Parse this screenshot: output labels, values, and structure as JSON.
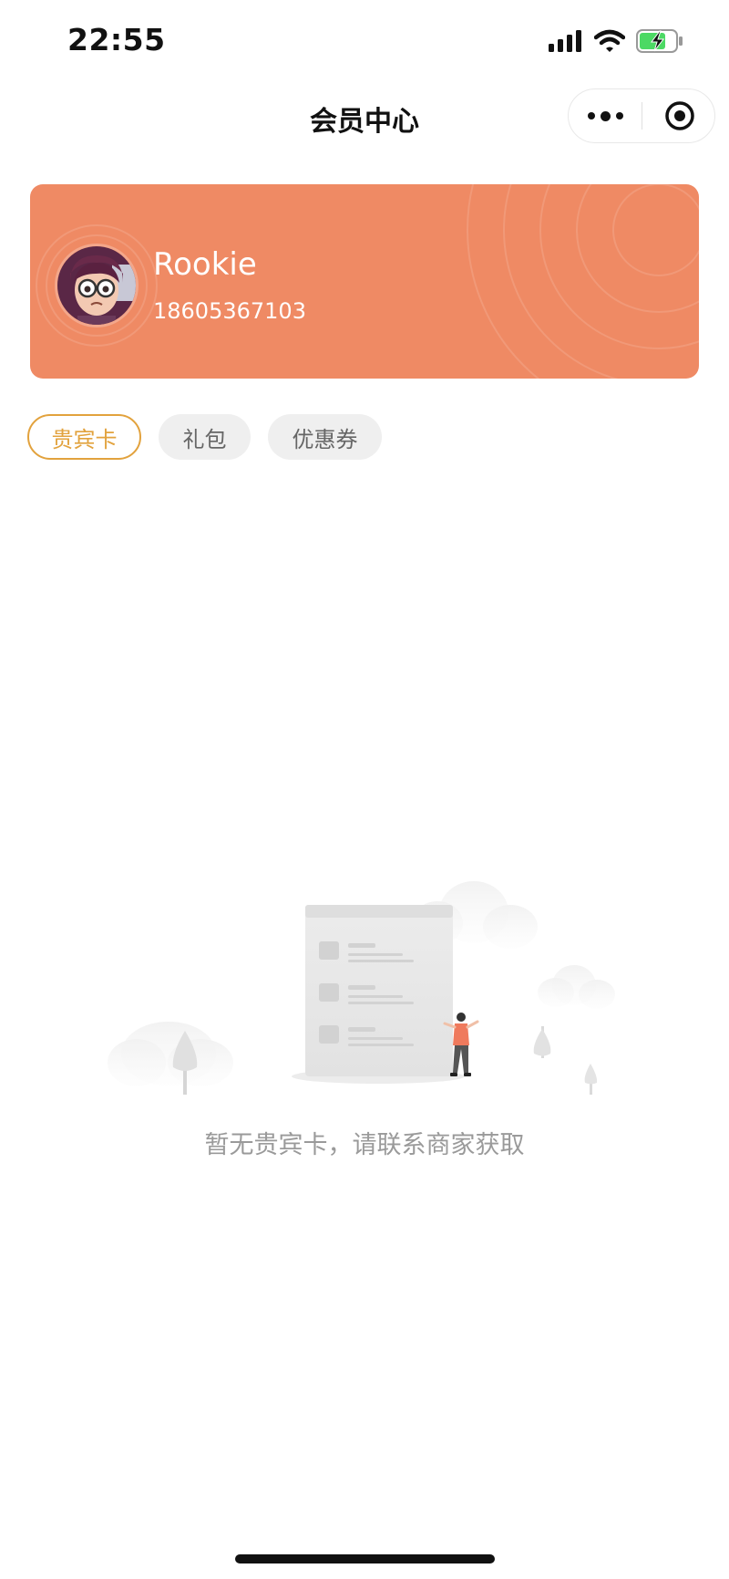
{
  "status_bar": {
    "time": "22:55",
    "icons": [
      "signal-icon",
      "wifi-icon",
      "battery-charging-icon"
    ]
  },
  "nav": {
    "title": "会员中心",
    "more_icon": "more-dots-icon",
    "close_icon": "target-close-icon"
  },
  "member": {
    "name": "Rookie",
    "phone": "18605367103",
    "card_color": "#ef8a64"
  },
  "tabs": [
    {
      "label": "贵宾卡",
      "active": true
    },
    {
      "label": "礼包",
      "active": false
    },
    {
      "label": "优惠券",
      "active": false
    }
  ],
  "empty_state": {
    "message": "暂无贵宾卡，请联系商家获取"
  },
  "colors": {
    "accent": "#e2a23d",
    "card": "#ef8a64"
  }
}
